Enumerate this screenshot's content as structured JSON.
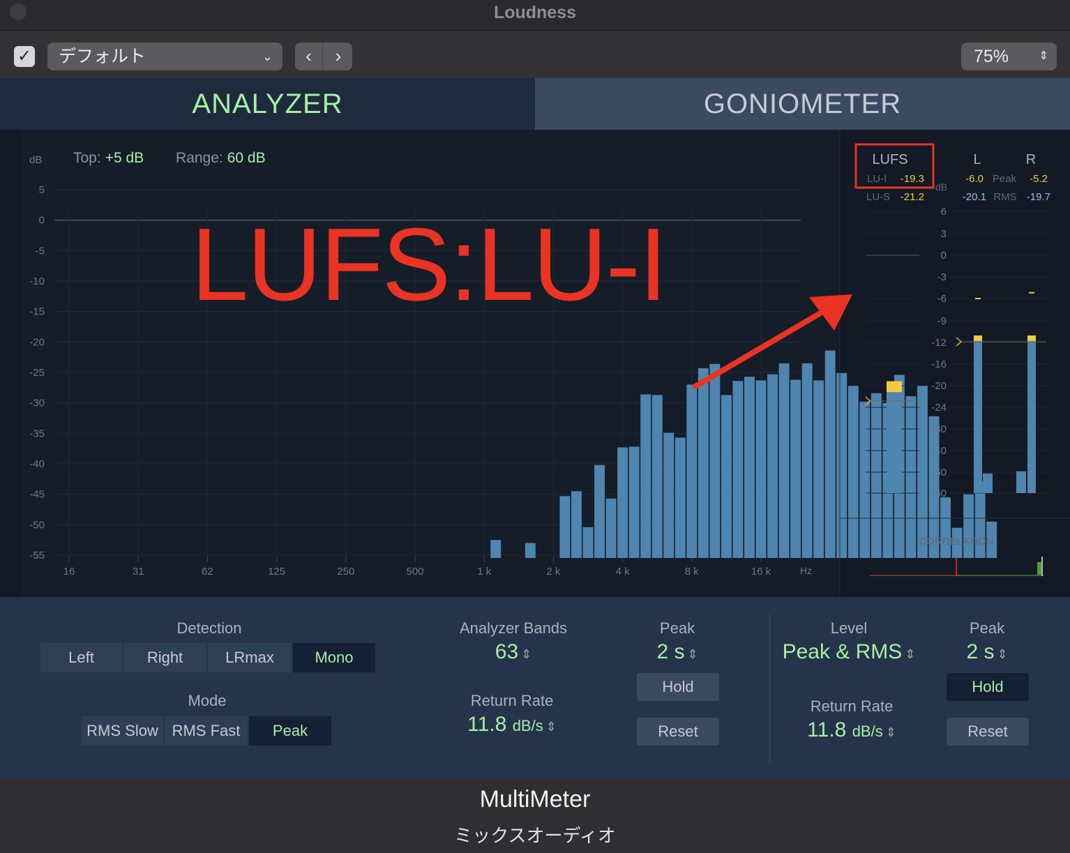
{
  "window": {
    "title": "Loudness"
  },
  "toolbar": {
    "preset": "デフォルト",
    "zoom": "75%"
  },
  "tabs": {
    "analyzer": "ANALYZER",
    "goniometer": "GONIOMETER"
  },
  "analyzer": {
    "db_label": "dB",
    "top_label": "Top:",
    "top_value": "+5 dB",
    "range_label": "Range:",
    "range_value": "60 dB",
    "hz_label": "Hz",
    "y_ticks": [
      "5",
      "0",
      "-5",
      "-10",
      "-15",
      "-20",
      "-25",
      "-30",
      "-35",
      "-40",
      "-45",
      "-50",
      "-55"
    ],
    "x_ticks": [
      "16",
      "31",
      "62",
      "125",
      "250",
      "500",
      "1 k",
      "2 k",
      "4 k",
      "8 k",
      "16 k"
    ]
  },
  "chart_data": {
    "type": "bar",
    "xlabel": "Hz",
    "ylabel": "dB",
    "ylim": [
      -55,
      5
    ],
    "bands_per_octave": 6,
    "start_band_center_hz": 16,
    "band_count": 63,
    "values_db": [
      null,
      null,
      null,
      null,
      null,
      null,
      null,
      null,
      null,
      null,
      null,
      null,
      null,
      null,
      null,
      null,
      null,
      null,
      null,
      null,
      null,
      null,
      null,
      null,
      null,
      null,
      null,
      null,
      null,
      null,
      null,
      null,
      null,
      null,
      null,
      null,
      null,
      -52.5,
      null,
      null,
      -53,
      null,
      null,
      -45.3,
      -44.5,
      -50.4,
      -40.2,
      -45.7,
      -37.3,
      -37.2,
      -28.6,
      -28.7,
      -34.9,
      -35.7,
      -27.0,
      -24.3,
      -23.6,
      -28.7,
      -26.4,
      -25.7,
      -26.3,
      -25.3,
      -23.5,
      -26.2,
      -23.5,
      -26.3,
      -21.4,
      -25.1,
      -27.2,
      -29.8,
      -28.4,
      -30.0,
      -25.4,
      -28.9,
      -27.2,
      -32.2,
      -45.5,
      -50.5,
      -45.0,
      -42.9,
      -49.5
    ],
    "lufs": {
      "lu_i": -19.3,
      "lu_s": -21.2
    },
    "peak": {
      "L": -6.0,
      "R": -5.2
    },
    "rms": {
      "L": -20.1,
      "R": -19.7
    }
  },
  "meters": {
    "lufs_title": "LUFS",
    "lu_i_label": "LU-I",
    "lu_i_value": "-19.3",
    "lu_s_label": "LU-S",
    "lu_s_value": "-21.2",
    "l_title": "L",
    "r_title": "R",
    "peak_label": "Peak",
    "rms_label": "RMS",
    "peak_l": "-6.0",
    "peak_r": "-5.2",
    "rms_l": "-20.1",
    "rms_r": "-19.7",
    "db_label": "dB",
    "scale": [
      "6",
      "3",
      "0",
      "-3",
      "-6",
      "-9",
      "-12",
      "-16",
      "-20",
      "-24",
      "-30",
      "-40",
      "-50",
      "-60"
    ],
    "correlation_label": "CORRELATION"
  },
  "annotation": {
    "text": "LUFS:LU-I"
  },
  "controls": {
    "detection_label": "Detection",
    "detection_options": [
      "Left",
      "Right",
      "LRmax",
      "Mono"
    ],
    "mode_label": "Mode",
    "mode_options": [
      "RMS Slow",
      "RMS Fast",
      "Peak"
    ],
    "analyzer_bands_label": "Analyzer Bands",
    "analyzer_bands_value": "63",
    "return_rate_label": "Return Rate",
    "return_rate_value": "11.8",
    "return_rate_unit": "dB/s",
    "peak_label": "Peak",
    "peak_value": "2 s",
    "hold_label": "Hold",
    "reset_label": "Reset",
    "level_label": "Level",
    "level_value": "Peak & RMS",
    "level_return_rate_label": "Return Rate",
    "level_return_rate_value": "11.8",
    "level_return_rate_unit": "dB/s",
    "level_peak_label": "Peak",
    "level_peak_value": "2 s",
    "level_hold_label": "Hold",
    "level_reset_label": "Reset"
  },
  "footer": {
    "name": "MultiMeter",
    "subtitle": "ミックスオーディオ"
  },
  "colors": {
    "accent_green": "#a8efa4",
    "bar_blue": "#4f85ae",
    "peak_yellow": "#f4c93f",
    "annotation_red": "#ea3323"
  }
}
